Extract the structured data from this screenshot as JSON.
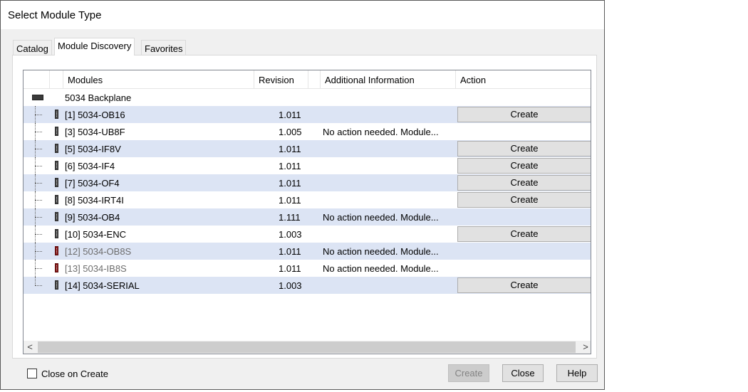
{
  "window": {
    "title": "Select Module Type"
  },
  "tabs": [
    {
      "label": "Catalog"
    },
    {
      "label": "Module Discovery",
      "active": true
    },
    {
      "label": "Favorites"
    }
  ],
  "grid": {
    "columns": [
      "Modules",
      "Revision",
      "Additional Information",
      "Action"
    ],
    "root": {
      "name": "5034 Backplane",
      "icon": "backplane-icon"
    },
    "rows": [
      {
        "name": "[1] 5034-OB16",
        "revision": "1.011",
        "info": "",
        "action": "Create",
        "icon": "module-icon",
        "dim": false
      },
      {
        "name": "[3] 5034-UB8F",
        "revision": "1.005",
        "info": "No action needed.  Module...",
        "action": "",
        "icon": "module-icon",
        "dim": false
      },
      {
        "name": "[5] 5034-IF8V",
        "revision": "1.011",
        "info": "",
        "action": "Create",
        "icon": "module-icon",
        "dim": false
      },
      {
        "name": "[6] 5034-IF4",
        "revision": "1.011",
        "info": "",
        "action": "Create",
        "icon": "module-icon",
        "dim": false
      },
      {
        "name": "[7] 5034-OF4",
        "revision": "1.011",
        "info": "",
        "action": "Create",
        "icon": "module-icon",
        "dim": false
      },
      {
        "name": "[8] 5034-IRT4I",
        "revision": "1.011",
        "info": "",
        "action": "Create",
        "icon": "module-icon",
        "dim": false
      },
      {
        "name": "[9] 5034-OB4",
        "revision": "1.111",
        "info": "No action needed.  Module...",
        "action": "",
        "icon": "module-icon",
        "dim": false
      },
      {
        "name": "[10] 5034-ENC",
        "revision": "1.003",
        "info": "",
        "action": "Create",
        "icon": "module-icon",
        "dim": false
      },
      {
        "name": "[12] 5034-OB8S",
        "revision": "1.011",
        "info": "No action needed.  Module...",
        "action": "",
        "icon": "safety-module-icon",
        "dim": true
      },
      {
        "name": "[13] 5034-IB8S",
        "revision": "1.011",
        "info": "No action needed.  Module...",
        "action": "",
        "icon": "safety-module-icon",
        "dim": true
      },
      {
        "name": "[14] 5034-SERIAL",
        "revision": "1.003",
        "info": "",
        "action": "Create",
        "icon": "module-icon",
        "dim": false
      }
    ],
    "scroll_left": "<",
    "scroll_right": ">"
  },
  "footer": {
    "close_on_create_label": "Close on Create",
    "close_on_create_checked": false,
    "create_label": "Create",
    "create_enabled": false,
    "close_label": "Close",
    "help_label": "Help"
  },
  "colors": {
    "alt_row": "#dce4f4",
    "dialog_bg": "#f0f0f0",
    "button_bg": "#e1e1e1"
  }
}
